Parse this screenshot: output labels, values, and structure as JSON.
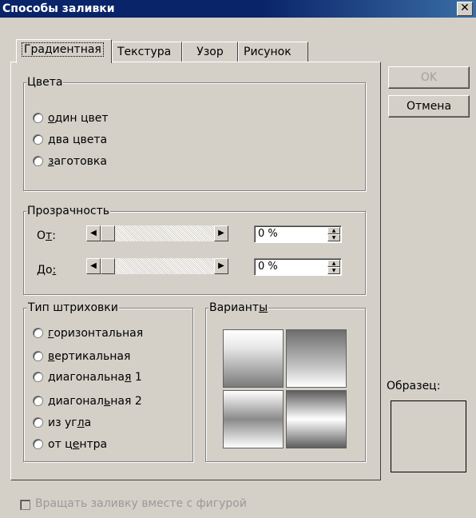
{
  "window": {
    "title": "Способы заливки",
    "close_glyph": "✕"
  },
  "tabs": [
    {
      "label": "Градиентная",
      "active": true
    },
    {
      "label": "Текстура",
      "active": false
    },
    {
      "label": "Узор",
      "active": false
    },
    {
      "label": "Рисунок",
      "active": false
    }
  ],
  "colors_group": {
    "title": "Цвета",
    "options": [
      {
        "pre": "",
        "key": "о",
        "post": "дин цвет"
      },
      {
        "pre": "",
        "key": "д",
        "post": "ва цвета"
      },
      {
        "pre": "",
        "key": "з",
        "post": "аготовка"
      }
    ]
  },
  "transparency_group": {
    "title": "Прозрачность",
    "from": {
      "pre": "О",
      "key": "т",
      "post": ":",
      "value": "0 %"
    },
    "to": {
      "pre": "До",
      "key": ":",
      "post": "",
      "value": "0 %"
    },
    "left_arrow": "◀",
    "right_arrow": "▶",
    "spin_up": "▲",
    "spin_down": "▼"
  },
  "shading_group": {
    "title": "Тип штриховки",
    "options": [
      {
        "pre": "",
        "key": "г",
        "post": "оризонтальная"
      },
      {
        "pre": "",
        "key": "в",
        "post": "ертикальная"
      },
      {
        "pre": "диагональна",
        "key": "я",
        "post": " 1"
      },
      {
        "pre": "диагонал",
        "key": "ь",
        "post": "ная 2"
      },
      {
        "pre": "из уг",
        "key": "л",
        "post": "а"
      },
      {
        "pre": "от ц",
        "key": "е",
        "post": "нтра"
      }
    ]
  },
  "variants_group": {
    "pre": "Вариант",
    "key": "ы",
    "post": ""
  },
  "buttons": {
    "ok": "OK",
    "cancel": "Отмена"
  },
  "sample": {
    "label": "Образец:"
  },
  "rotate_checkbox": {
    "label": "Вращать заливку вместе с фигурой",
    "checked": false,
    "enabled": false
  }
}
